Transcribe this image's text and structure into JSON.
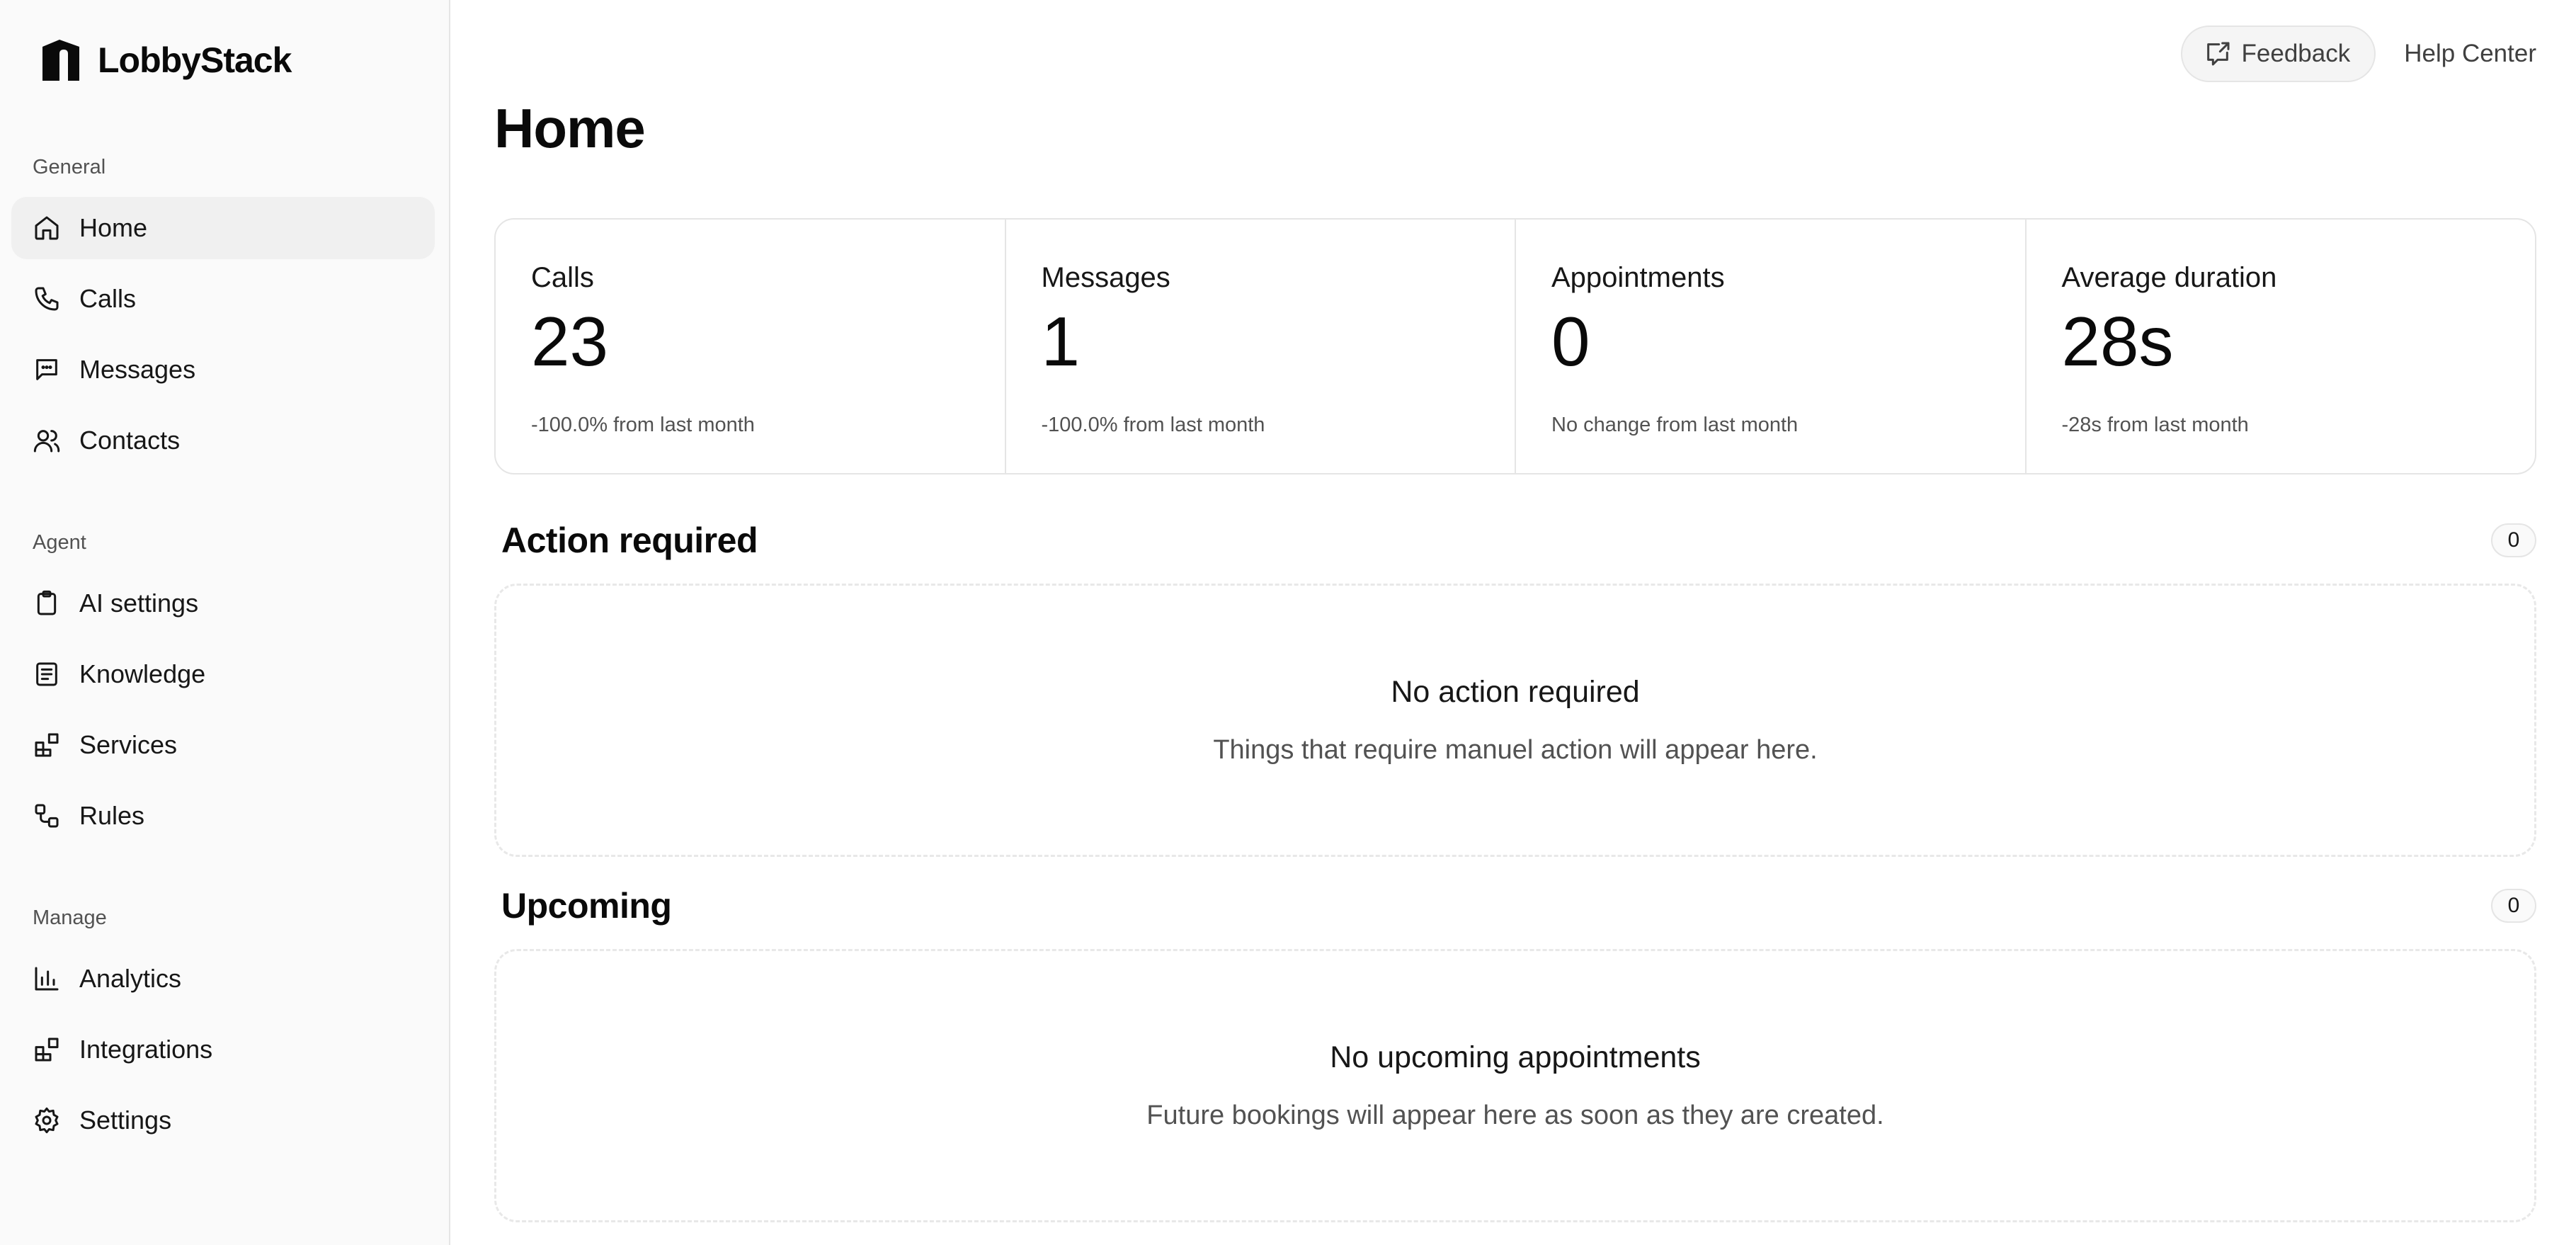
{
  "brand": {
    "name": "LobbyStack"
  },
  "sidebar": {
    "sections": [
      {
        "label": "General",
        "items": [
          {
            "label": "Home",
            "icon": "home-icon",
            "active": true
          },
          {
            "label": "Calls",
            "icon": "phone-icon"
          },
          {
            "label": "Messages",
            "icon": "message-icon"
          },
          {
            "label": "Contacts",
            "icon": "users-icon"
          }
        ]
      },
      {
        "label": "Agent",
        "items": [
          {
            "label": "AI settings",
            "icon": "clipboard-icon"
          },
          {
            "label": "Knowledge",
            "icon": "book-icon"
          },
          {
            "label": "Services",
            "icon": "blocks-icon"
          },
          {
            "label": "Rules",
            "icon": "workflow-icon"
          }
        ]
      },
      {
        "label": "Manage",
        "items": [
          {
            "label": "Analytics",
            "icon": "bar-chart-icon"
          },
          {
            "label": "Integrations",
            "icon": "blocks-icon"
          },
          {
            "label": "Settings",
            "icon": "gear-icon"
          }
        ]
      }
    ]
  },
  "header": {
    "feedback_label": "Feedback",
    "help_label": "Help Center"
  },
  "page": {
    "title": "Home"
  },
  "stats": [
    {
      "label": "Calls",
      "value": "23",
      "change": "-100.0% from last month"
    },
    {
      "label": "Messages",
      "value": "1",
      "change": "-100.0% from last month"
    },
    {
      "label": "Appointments",
      "value": "0",
      "change": "No change from last month"
    },
    {
      "label": "Average duration",
      "value": "28s",
      "change": "-28s from last month"
    }
  ],
  "action_required": {
    "title": "Action required",
    "count": "0",
    "empty_title": "No action required",
    "empty_desc": "Things that require manuel action will appear here."
  },
  "upcoming": {
    "title": "Upcoming",
    "count": "0",
    "empty_title": "No upcoming appointments",
    "empty_desc": "Future bookings will appear here as soon as they are created."
  }
}
